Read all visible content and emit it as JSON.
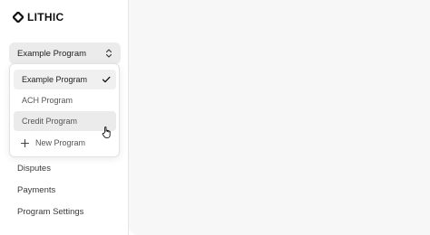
{
  "brand": {
    "name": "LITHIC",
    "logo_icon": "lithic-logo-icon"
  },
  "program_selector": {
    "selected_value": "Example Program",
    "icon": "chevron-up-down-icon"
  },
  "dropdown": {
    "options": [
      {
        "label": "Example Program",
        "selected": true,
        "icon": "check-icon"
      },
      {
        "label": "ACH Program",
        "selected": false
      },
      {
        "label": "Credit Program",
        "selected": false,
        "hovered": true
      }
    ],
    "new_program_label": "New Program",
    "new_program_icon": "plus-icon"
  },
  "cursor_icon": "hand-pointer-icon",
  "nav": {
    "items": [
      {
        "label": "Disputes"
      },
      {
        "label": "Payments"
      },
      {
        "label": "Program Settings"
      }
    ]
  },
  "colors": {
    "sidebar_bg": "#ffffff",
    "main_bg": "#f7f7f7",
    "selector_bg": "#ebebeb",
    "hover_bg": "#ebebeb",
    "text": "#1f1f1f"
  }
}
